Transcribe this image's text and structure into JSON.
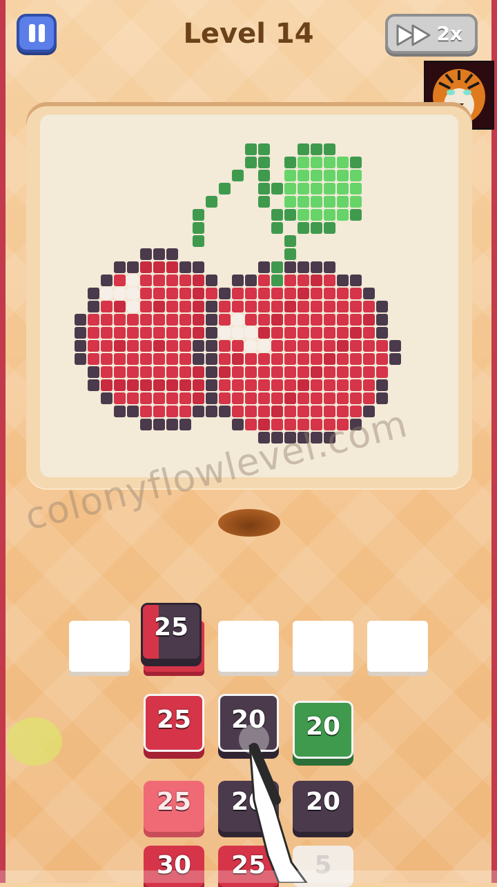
{
  "header": {
    "level_title": "Level 14",
    "speed_label": "2x"
  },
  "watermark": "colonyflowlevel.com",
  "colors": {
    "red": "#d63449",
    "dark": "#4a3a4c",
    "green": "#3f9a4e",
    "pink": "#f06a76",
    "slot": "#ffffff"
  },
  "queue_slots": [
    {
      "content": ""
    },
    {
      "content": "25"
    },
    {
      "content": ""
    },
    {
      "content": ""
    },
    {
      "content": ""
    }
  ],
  "grid": {
    "row1": [
      "25",
      "20",
      "20"
    ],
    "row2": [
      "25",
      "20",
      "20"
    ],
    "row3": [
      "30",
      "25",
      "5"
    ]
  }
}
